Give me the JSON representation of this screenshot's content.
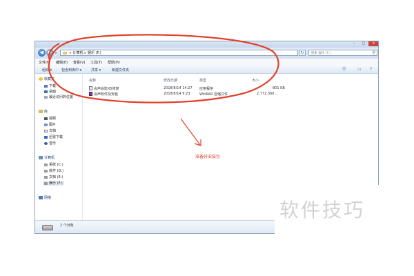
{
  "window": {
    "controls": {
      "minimize": "–",
      "maximize": "□",
      "close": "✕"
    },
    "nav": {
      "back_icon": "◀",
      "forward_icon": "▶",
      "history_icon": "▾"
    },
    "breadcrumb": {
      "root": "计算机",
      "current": "娱乐 (F:)"
    },
    "refresh_icon": "↻",
    "search": {
      "placeholder": "搜索 娱乐 (F:)",
      "icon": "⚲"
    }
  },
  "menubar": [
    "文件(F)",
    "编辑(E)",
    "查看(V)",
    "工具(T)",
    "帮助(H)"
  ],
  "toolbar": {
    "organize": "组织 ▾",
    "include": "包含到库中 ▾",
    "share": "共享 ▾",
    "new_folder": "新建文件夹",
    "view_icon": "☷",
    "pane_icon": "▭",
    "help_icon": "?"
  },
  "sidebar": {
    "favorites": {
      "label": "收藏夹",
      "items": [
        "下载",
        "桌面",
        "最近访问的位置"
      ]
    },
    "libraries": {
      "label": "库",
      "items": [
        "视频",
        "图片",
        "文档",
        "迅雷下载",
        "音乐"
      ]
    },
    "computer": {
      "label": "计算机",
      "items": [
        "系统 (C:)",
        "软件 (D:)",
        "文档 (E:)",
        "娱乐 (F:)"
      ]
    },
    "network": {
      "label": "网络"
    }
  },
  "columns": [
    "名称",
    "修改日期",
    "类型",
    "大小"
  ],
  "files": [
    {
      "name": "会声会影X5修复",
      "modified": "2018/8/14 14:27",
      "type": "应用程序",
      "size": "801 KB"
    },
    {
      "name": "会声软件及安装",
      "modified": "2018/8/14 9:23",
      "type": "WinRAR 压缩文件",
      "size": "2,772,360..."
    }
  ],
  "status": {
    "count": "2 个对象"
  },
  "annotation": "准备好安装包",
  "watermark": "软件技巧",
  "colors": {
    "annotation": "#e0402a",
    "watermark": "#d2d2d2"
  }
}
